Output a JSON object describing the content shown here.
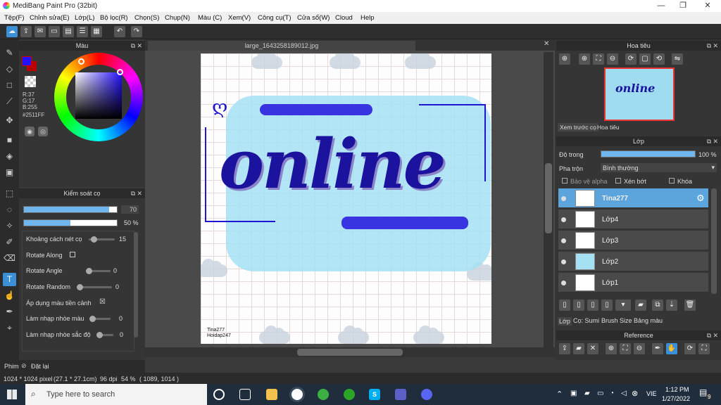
{
  "window": {
    "title": "MediBang Paint Pro (32bit)",
    "minimize": "—",
    "maximize": "❐",
    "close": "✕"
  },
  "menu": [
    "Tệp(F)",
    "Chỉnh sửa(E)",
    "Lớp(L)",
    "Bộ lọc(R)",
    "Chọn(S)",
    "Chụp(N)",
    "Màu (C)",
    "Xem(V)",
    "Công cụ(T)",
    "Cửa sổ(W)",
    "Cloud",
    "Help"
  ],
  "color_panel": {
    "title": "Màu",
    "r": "R:37",
    "g": "G:17",
    "b": "B:255",
    "hex": "#2511FF",
    "fg_color": "#2511ff"
  },
  "brush_panel": {
    "title": "Kiểm soát cọ",
    "size_value": "70",
    "opacity_value": "50 %",
    "size_level": 0.92,
    "opacity_level": 0.5,
    "rows": [
      {
        "label": "Khoảng cách nét cọ",
        "value": "15",
        "type": "slider"
      },
      {
        "label": "Rotate Along",
        "value": "",
        "type": "check"
      },
      {
        "label": "Rotate Angle",
        "value": "0",
        "type": "slider"
      },
      {
        "label": "Rotate Random",
        "value": "0",
        "type": "slider"
      },
      {
        "label": "Áp dụng màu tiền cảnh",
        "value": "☒",
        "type": "check"
      },
      {
        "label": "Làm nhạp nhòe màu",
        "value": "0",
        "type": "slider"
      },
      {
        "label": "Làm nhạp nhòe sắc độ",
        "value": "0",
        "type": "slider"
      }
    ]
  },
  "canvas": {
    "tab": "large_1643258189012.jpg",
    "artwork_text": "online",
    "credit1": "Tina277",
    "credit2": "Hoidap247"
  },
  "bottom_left": {
    "tab": "Phim",
    "reset": "Đặt lại"
  },
  "status": {
    "size": "1024 * 1024 pixel",
    "dims": "(27.1 * 27.1cm)",
    "dpi": "96 dpi",
    "zoom": "54 %",
    "coords": "( 1089, 1014 )"
  },
  "navigator": {
    "title": "Hoa tiêu",
    "tab1": "Xem trước cọ",
    "tab2": "Hoa tiêu"
  },
  "layers": {
    "title": "Lớp",
    "opacity_label": "Độ trong",
    "opacity_value": "100 %",
    "blend_label": "Pha trộn",
    "blend_value": "Bình thường",
    "protect_alpha": "Bảo vệ alpha",
    "clip": "Xén bớt",
    "lock": "Khóa",
    "items": [
      {
        "name": "Tina277",
        "selected": true
      },
      {
        "name": "Lớp4",
        "selected": false
      },
      {
        "name": "Lớp3",
        "selected": false
      },
      {
        "name": "Lớp2",
        "selected": false
      },
      {
        "name": "Lớp1",
        "selected": false
      }
    ],
    "tabs": [
      "Lớp",
      "Cọ: Sumi",
      "Brush Size",
      "Bảng màu"
    ]
  },
  "reference": {
    "title": "Reference"
  },
  "taskbar": {
    "search_placeholder": "Type here to search",
    "lang": "VIE",
    "time": "1:12 PM",
    "date": "1/27/2022",
    "notif": "9"
  }
}
